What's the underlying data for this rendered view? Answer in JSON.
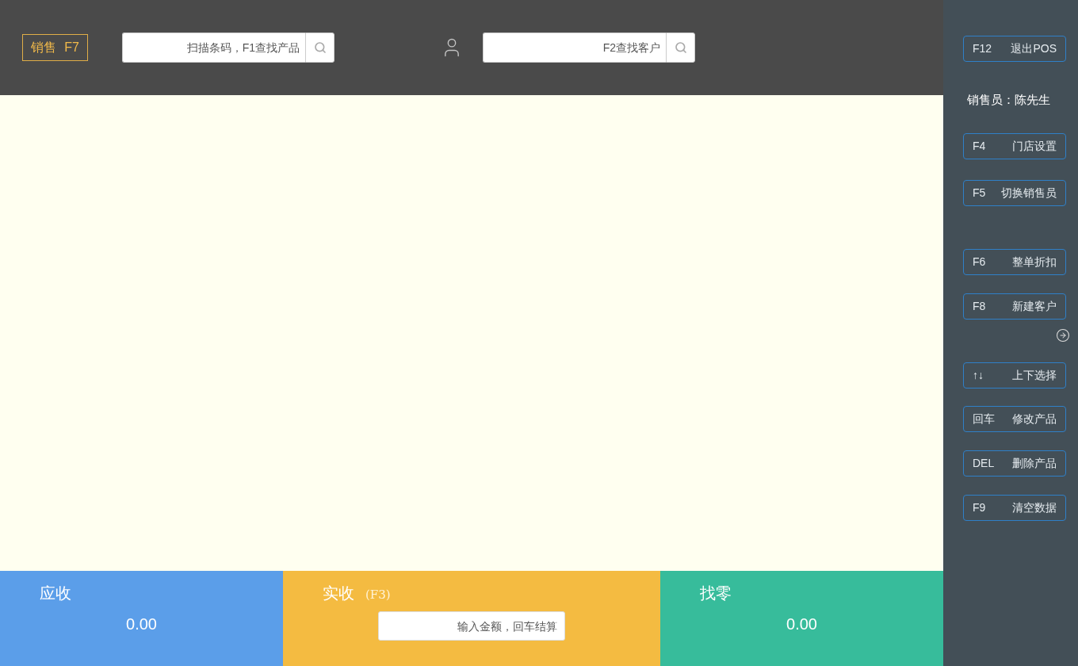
{
  "top_bar": {
    "mode_button": {
      "label": "销售",
      "key": "F7"
    },
    "product_search": {
      "placeholder": "扫描条码，F1查找产品"
    },
    "customer_search": {
      "placeholder": "F2查找客户"
    }
  },
  "totals": [
    {
      "kind": "amount",
      "label": "应收",
      "value": "0.00",
      "color": "#5b9ee9"
    },
    {
      "kind": "input",
      "label": "实收",
      "shortcut": "(F3)",
      "placeholder": "输入金额，回车结算",
      "color": "#f4bb41"
    },
    {
      "kind": "amount",
      "label": "找零",
      "value": "0.00",
      "color": "#37bc9b"
    }
  ],
  "sidebar": {
    "exit_button": {
      "key": "F12",
      "label": "退出POS"
    },
    "salesperson": "销售员：陈先生",
    "buttons": [
      {
        "key": "F4",
        "label": "门店设置"
      },
      {
        "key": "F5",
        "label": "切换销售员"
      },
      {
        "key": "F6",
        "label": "整单折扣"
      },
      {
        "key": "F8",
        "label": "新建客户"
      },
      {
        "key": "↑↓",
        "label": "上下选择"
      },
      {
        "key": "回车",
        "label": "修改产品"
      },
      {
        "key": "DEL",
        "label": "删除产品"
      },
      {
        "key": "F9",
        "label": "清空数据"
      }
    ]
  }
}
